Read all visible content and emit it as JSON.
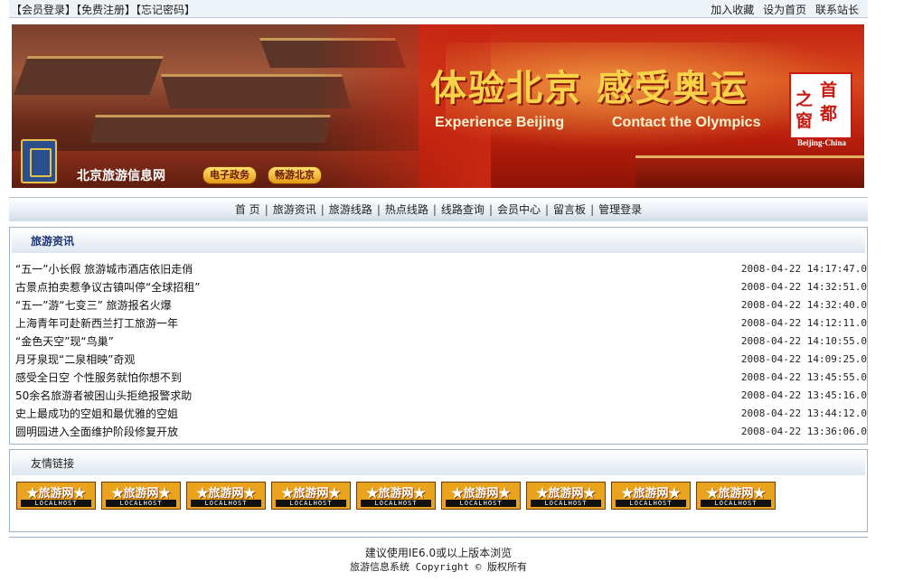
{
  "topbar": {
    "member_login": "【会员登录】",
    "register": "【免费注册】",
    "forgot_password": "【忘记密码】",
    "add_favorite": "加入收藏",
    "set_homepage": "设为首页",
    "contact": "联系站长"
  },
  "banner": {
    "slogan_cn": "体验北京 感受奥运",
    "slogan_en_1": "Experience Beijing",
    "slogan_en_2": "Contact the Olympics",
    "stamp_chars": [
      "首",
      "之",
      "都",
      "窗"
    ],
    "stamp_sub": "Beijing-China",
    "site_name": "北京旅游信息网",
    "button_1": "电子政务",
    "button_2": "畅游北京"
  },
  "nav": {
    "items": [
      "首 页",
      "旅游资讯",
      "旅游线路",
      "热点线路",
      "线路查询",
      "会员中心",
      "留言板",
      "管理登录"
    ]
  },
  "news": {
    "title": "旅游资讯",
    "items": [
      {
        "title": "“五一”小长假 旅游城市酒店依旧走俏",
        "date": "2008-04-22 14:17:47.0"
      },
      {
        "title": "古景点拍卖惹争议古镇叫停“全球招租”",
        "date": "2008-04-22 14:32:51.0"
      },
      {
        "title": "“五一”游“七变三” 旅游报名火爆",
        "date": "2008-04-22 14:32:40.0"
      },
      {
        "title": "上海青年可赴新西兰打工旅游一年",
        "date": "2008-04-22 14:12:11.0"
      },
      {
        "title": "“金色天空”现“鸟巢”",
        "date": "2008-04-22 14:10:55.0"
      },
      {
        "title": "月牙泉现“二泉相映”奇观",
        "date": "2008-04-22 14:09:25.0"
      },
      {
        "title": "感受全日空 个性服务就怕你想不到",
        "date": "2008-04-22 13:45:55.0"
      },
      {
        "title": "50余名旅游者被困山头拒绝报警求助",
        "date": "2008-04-22 13:45:16.0"
      },
      {
        "title": "史上最成功的空姐和最优雅的空姐",
        "date": "2008-04-22 13:44:12.0"
      },
      {
        "title": "圆明园进入全面维护阶段修复开放",
        "date": "2008-04-22 13:36:06.0"
      }
    ]
  },
  "friend_links": {
    "title": "友情链接",
    "items": [
      {
        "top": "★旅游网★",
        "bottom": "LOCALHOST"
      },
      {
        "top": "★旅游网★",
        "bottom": "LOCALHOST"
      },
      {
        "top": "★旅游网★",
        "bottom": "LOCALHOST"
      },
      {
        "top": "★旅游网★",
        "bottom": "LOCALHOST"
      },
      {
        "top": "★旅游网★",
        "bottom": "LOCALHOST"
      },
      {
        "top": "★旅游网★",
        "bottom": "LOCALHOST"
      },
      {
        "top": "★旅游网★",
        "bottom": "LOCALHOST"
      },
      {
        "top": "★旅游网★",
        "bottom": "LOCALHOST"
      },
      {
        "top": "★旅游网★",
        "bottom": "LOCALHOST"
      }
    ]
  },
  "footer": {
    "line1": "建议使用IE6.0或以上版本浏览",
    "line2": "旅游信息系统 Copyright © 版权所有"
  }
}
